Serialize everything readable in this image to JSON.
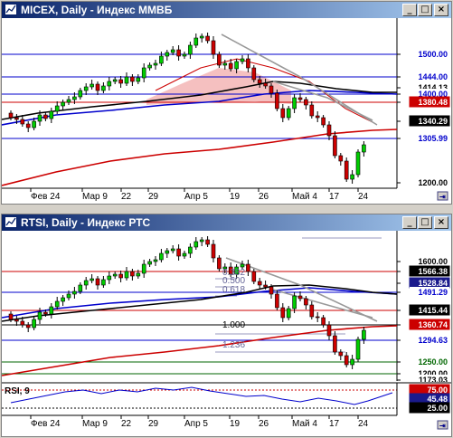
{
  "window1": {
    "title": "MICEX, Daily - Индекс ММВБ",
    "minimize": "_",
    "maximize": "□",
    "close": "×",
    "price_labels": [
      {
        "text": "1500.00",
        "bg": "#ffffff",
        "fg": "#0000cc"
      },
      {
        "text": "1444.00",
        "bg": "#ffffff",
        "fg": "#0000cc"
      },
      {
        "text": "1414.13",
        "bg": "#ffffff",
        "fg": "#000000"
      },
      {
        "text": "1400.00",
        "bg": "#ffffff",
        "fg": "#0000cc"
      },
      {
        "text": "1380.48",
        "bg": "#cc0000",
        "fg": "#ffffff"
      },
      {
        "text": "1340.29",
        "bg": "#000000",
        "fg": "#ffffff"
      },
      {
        "text": "1305.99",
        "bg": "#ffffff",
        "fg": "#0000cc"
      },
      {
        "text": "1200.00",
        "bg": "#ffffff",
        "fg": "#000000"
      }
    ],
    "date_labels": [
      "Фев 24",
      "Мар 9",
      "22",
      "29",
      "Апр 5",
      "19",
      "26",
      "Май 4",
      "17",
      "24"
    ]
  },
  "window2": {
    "title": "RTSI, Daily - Индекс РТС",
    "minimize": "_",
    "maximize": "□",
    "close": "×",
    "price_labels": [
      {
        "text": "1600.00",
        "bg": "#ffffff",
        "fg": "#000000"
      },
      {
        "text": "1566.38",
        "bg": "#000000",
        "fg": "#ffffff"
      },
      {
        "text": "1528.84",
        "bg": "#1a1a8c",
        "fg": "#ffffff"
      },
      {
        "text": "1491.29",
        "bg": "#ffffff",
        "fg": "#0000cc"
      },
      {
        "text": "1415.44",
        "bg": "#000000",
        "fg": "#ffffff"
      },
      {
        "text": "1360.74",
        "bg": "#cc0000",
        "fg": "#ffffff"
      },
      {
        "text": "1294.63",
        "bg": "#ffffff",
        "fg": "#0000cc"
      },
      {
        "text": "1250.00",
        "bg": "#ffffff",
        "fg": "#006600"
      },
      {
        "text": "1200.00",
        "bg": "#ffffff",
        "fg": "#000000"
      },
      {
        "text": "1173.03",
        "bg": "#ffffff",
        "fg": "#000000"
      }
    ],
    "fib_labels": [
      "0.382",
      "0.500",
      "0.618",
      "1.000",
      "1.236"
    ],
    "rsi": {
      "title": "RSI, 9",
      "labels": [
        {
          "text": "75.00",
          "bg": "#cc0000",
          "fg": "#ffffff"
        },
        {
          "text": "45.48",
          "bg": "#1a1a8c",
          "fg": "#ffffff"
        },
        {
          "text": "25.00",
          "bg": "#000000",
          "fg": "#ffffff"
        }
      ]
    },
    "date_labels": [
      "Фев 24",
      "Мар 9",
      "22",
      "29",
      "Апр 5",
      "19",
      "26",
      "Май 4",
      "17",
      "24"
    ]
  },
  "colors": {
    "bull_candle": "#00cc00",
    "bear_candle": "#cc0000",
    "ma_long": "#cc0000",
    "ma_mid": "#0000cc",
    "ma_short": "#000000",
    "cloud": "#f5c0c0"
  },
  "icons": [
    "chart-window-icon",
    "minimize-icon",
    "maximize-icon",
    "close-icon",
    "scroll-right-icon"
  ]
}
